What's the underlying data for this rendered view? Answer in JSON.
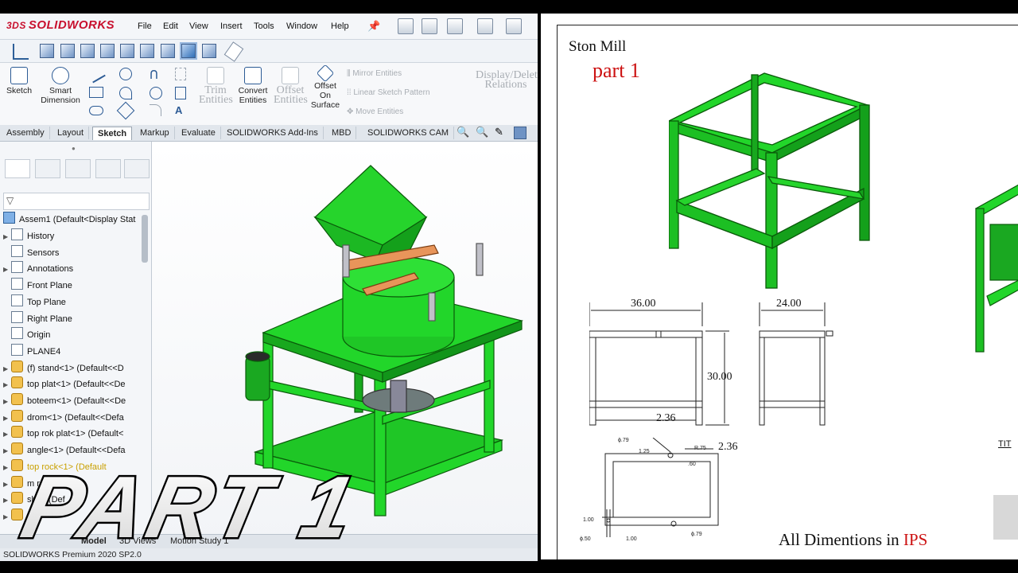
{
  "app": {
    "logo_text": "SOLIDWORKS",
    "menu": [
      "File",
      "Edit",
      "View",
      "Insert",
      "Tools",
      "Window",
      "Help"
    ]
  },
  "ribbon": {
    "sketch": "Sketch",
    "smart_dimension": [
      "Smart",
      "Dimension"
    ],
    "trim_entities": [
      "Trim",
      "Entities"
    ],
    "convert_entities": [
      "Convert",
      "Entities"
    ],
    "offset_entities": [
      "Offset",
      "Entities"
    ],
    "offset_on_surface": [
      "Offset",
      "On",
      "Surface"
    ],
    "mirror_entities": "Mirror Entities",
    "linear_sketch_pattern": "Linear Sketch Pattern",
    "move_entities": "Move Entities",
    "display_delete_relations": [
      "Display/Delete",
      "Relations"
    ]
  },
  "tabs": [
    "Assembly",
    "Layout",
    "Sketch",
    "Markup",
    "Evaluate",
    "SOLIDWORKS Add-Ins",
    "MBD",
    "SOLIDWORKS CAM"
  ],
  "active_tab": "Sketch",
  "tree": {
    "root": "Assem1  (Default<Display Stat",
    "items": [
      {
        "label": "History",
        "icon": "history-icon",
        "arrow": true
      },
      {
        "label": "Sensors",
        "icon": "sensors-icon",
        "arrow": false
      },
      {
        "label": "Annotations",
        "icon": "annotations-icon",
        "arrow": true
      },
      {
        "label": "Front Plane",
        "icon": "plane-icon",
        "arrow": false
      },
      {
        "label": "Top Plane",
        "icon": "plane-icon",
        "arrow": false
      },
      {
        "label": "Right Plane",
        "icon": "plane-icon",
        "arrow": false
      },
      {
        "label": "Origin",
        "icon": "origin-icon",
        "arrow": false
      },
      {
        "label": "PLANE4",
        "icon": "plane-icon",
        "arrow": false
      },
      {
        "label": "(f) stand<1> (Default<<D",
        "icon": "part-icon",
        "arrow": true
      },
      {
        "label": "top plat<1> (Default<<De",
        "icon": "part-icon",
        "arrow": true
      },
      {
        "label": "boteem<1> (Default<<De",
        "icon": "part-icon",
        "arrow": true
      },
      {
        "label": "drom<1> (Default<<Defa",
        "icon": "part-icon",
        "arrow": true
      },
      {
        "label": "top rok plat<1> (Default<",
        "icon": "part-icon",
        "arrow": true
      },
      {
        "label": "angle<1> (Default<<Defa",
        "icon": "part-icon",
        "arrow": true
      },
      {
        "label": "top rock<1> (Default",
        "icon": "warning-icon",
        "arrow": true,
        "warn": true
      },
      {
        "label": "m rock",
        "icon": "part-icon",
        "arrow": true
      },
      {
        "label": "shaft (Def",
        "icon": "part-icon",
        "arrow": true
      },
      {
        "label": "",
        "icon": "part-icon",
        "arrow": true
      }
    ]
  },
  "bottom_tabs": [
    "Model",
    "3D Views",
    "Motion Study 1"
  ],
  "bottom_partial": "me",
  "status": "SOLIDWORKS Premium 2020 SP2.0",
  "overlay_text": "PART 1",
  "drawing": {
    "title": "Ston Mill",
    "subtitle": "part 1",
    "dims": {
      "width": "36.00",
      "depth": "24.00",
      "height": "30.00",
      "offset": "2.36",
      "offset2": "2.36",
      "hole_dia": "ϕ.79",
      "radius": "R.75",
      "d125": "1.25",
      "d60": ".60",
      "d100a": "1.00",
      "d100b": "1.00",
      "hole_dia2": "ϕ.50",
      "hole_dia3": "ϕ.79"
    },
    "footer_prefix": "All Dimentions in",
    "footer_unit": "IPS",
    "title_block_partial": "TIT"
  },
  "colors": {
    "frame_green": "#22d62a",
    "frame_stroke": "#0a5a0a",
    "accent_red": "#cc1111",
    "sw_red": "#c8102e"
  }
}
